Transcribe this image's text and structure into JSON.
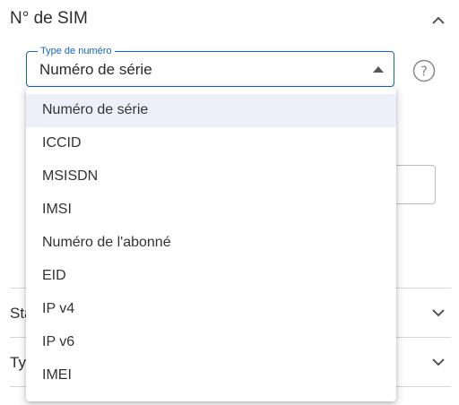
{
  "section": {
    "title": "N° de SIM"
  },
  "type_field": {
    "legend": "Type de numéro",
    "value": "Numéro de série"
  },
  "menu": {
    "items": [
      "Numéro de série",
      "ICCID",
      "MSISDN",
      "IMSI",
      "Numéro de l'abonné",
      "EID",
      "IP v4",
      "IP v6",
      "IMEI"
    ],
    "selected_index": 0
  },
  "accordion": {
    "status_label": "Sta",
    "type_label": "Ty"
  },
  "colors": {
    "accent": "#1565c0",
    "selected_bg": "#edf0f9",
    "divider": "#d6d6d6"
  }
}
